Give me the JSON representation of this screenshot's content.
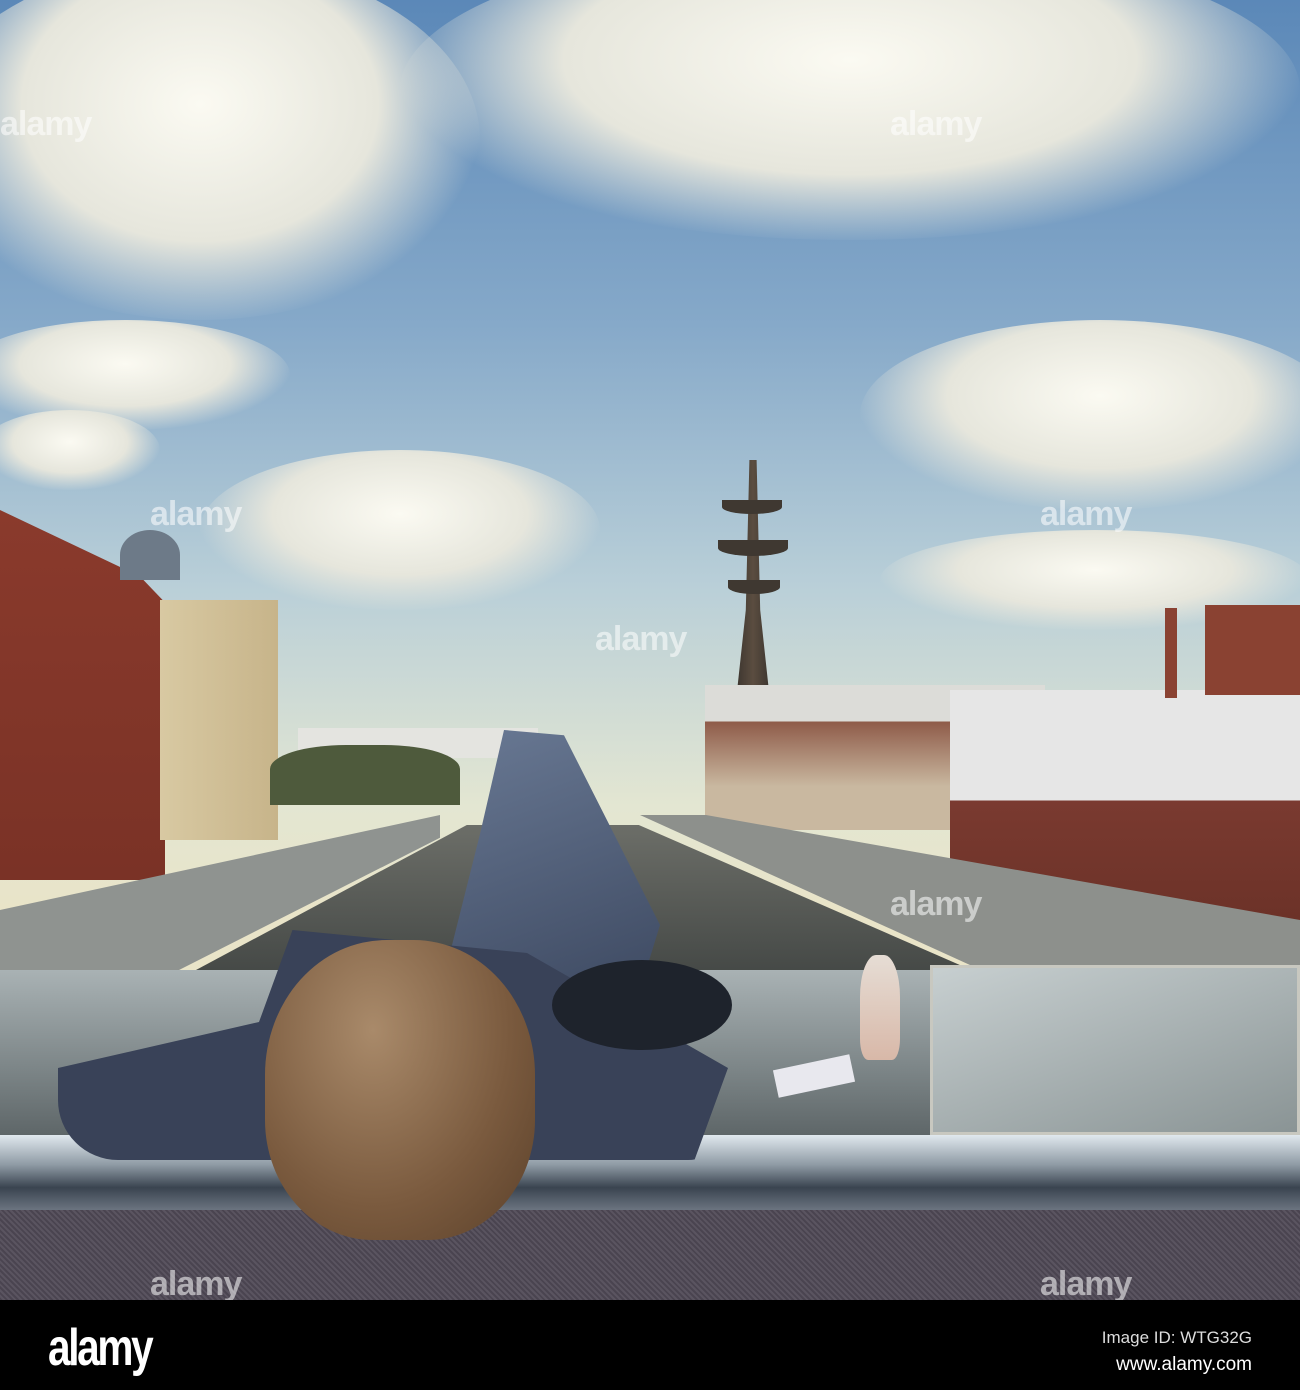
{
  "watermark": {
    "logo": "alamy",
    "image_id": "Image ID: WTG32G",
    "website": "www.alamy.com"
  },
  "overlay_watermark": "alamy"
}
